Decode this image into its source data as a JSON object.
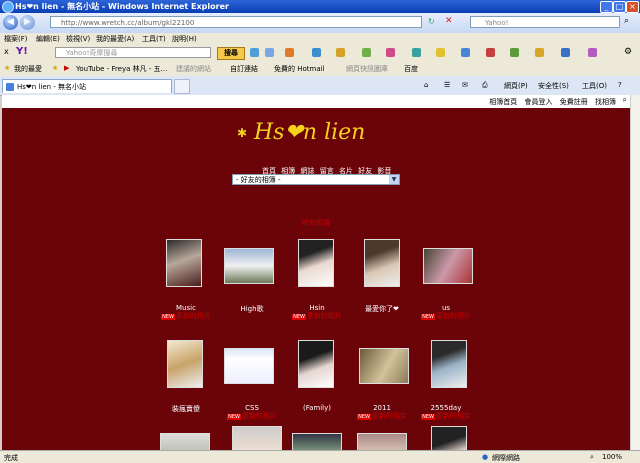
{
  "window": {
    "title": "Hs❤n lien - 無名小站 - Windows Internet Explorer"
  },
  "address": {
    "url": "http://www.wretch.cc/album/gkl22100",
    "search_placeholder": "Yahoo!"
  },
  "menu": [
    "檔案(F)",
    "編輯(E)",
    "檢視(V)",
    "我的最愛(A)",
    "工具(T)",
    "說明(H)"
  ],
  "yahoo_toolbar": {
    "search_placeholder": "Yahoo!奇摩搜尋",
    "search_button": "搜尋"
  },
  "favorites": {
    "label": "我的最愛",
    "items": [
      "YouTube - Freya 林凡 - 五...",
      "建議的網站",
      "自訂連結",
      "免費的 Hotmail",
      "網頁快訊圖庫",
      "百度"
    ]
  },
  "tab": {
    "title": "Hs❤n lien - 無名小站"
  },
  "cmdbar": [
    "網頁(P)",
    "安全性(S)",
    "工具(O)"
  ],
  "page": {
    "top_links": [
      "相簿首頁",
      "會員登入",
      "免費註冊",
      "找相簿"
    ],
    "logo": "Hs❤n lien",
    "nav": [
      "首頁",
      "相簿",
      "網誌",
      "留言",
      "名片",
      "好友",
      "影音"
    ],
    "album_select": "- 好友的相簿 -",
    "albums_header": "所有相簿",
    "new_badge": "NEW",
    "albums_row1": [
      {
        "caption": "Music",
        "sub": "更新的相片"
      },
      {
        "caption": "High歌",
        "sub": ""
      },
      {
        "caption": "Hsin",
        "sub": "更新的相片"
      },
      {
        "caption": "最愛你了❤",
        "sub": ""
      },
      {
        "caption": "us",
        "sub": "更新的相片"
      }
    ],
    "albums_row2": [
      {
        "caption": "裝瘋賣傻",
        "sub": ""
      },
      {
        "caption": "CSS",
        "sub": "更新的相片"
      },
      {
        "caption": "(Family)",
        "sub": ""
      },
      {
        "caption": "2011",
        "sub": "更新的相片"
      },
      {
        "caption": "2555day",
        "sub": "更新的相片"
      }
    ]
  },
  "status": {
    "left": "完成",
    "zone": "網際網路",
    "zoom": "100%"
  }
}
